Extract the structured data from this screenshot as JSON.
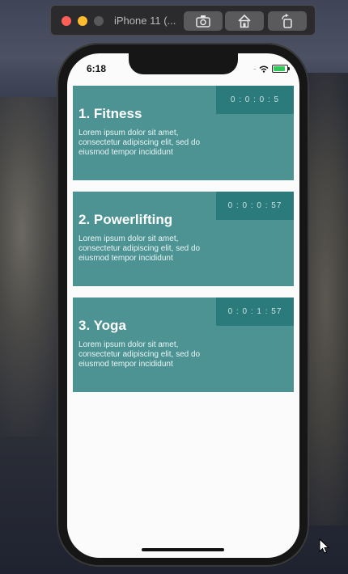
{
  "simulator": {
    "title": "iPhone 11 (..."
  },
  "status_bar": {
    "time": "6:18",
    "signal": "....."
  },
  "workouts": [
    {
      "title": "1. Fitness",
      "timer": "0 : 0 : 0 : 5",
      "description": "Lorem ipsum dolor sit amet, consectetur adipiscing elit, sed do eiusmod tempor incididunt"
    },
    {
      "title": "2. Powerlifting",
      "timer": "0 : 0 : 0 : 57",
      "description": "Lorem ipsum dolor sit amet, consectetur adipiscing elit, sed do eiusmod tempor incididunt"
    },
    {
      "title": "3. Yoga",
      "timer": "0 : 0 : 1 : 57",
      "description": "Lorem ipsum dolor sit amet, consectetur adipiscing elit, sed do eiusmod tempor incididunt"
    }
  ],
  "colors": {
    "card": "#4d9393",
    "timer_bg": "#2c7b7c"
  },
  "icons": [
    "camera-icon",
    "home-icon",
    "rotate-icon",
    "wifi-icon",
    "battery-icon",
    "mouse-cursor-icon"
  ]
}
